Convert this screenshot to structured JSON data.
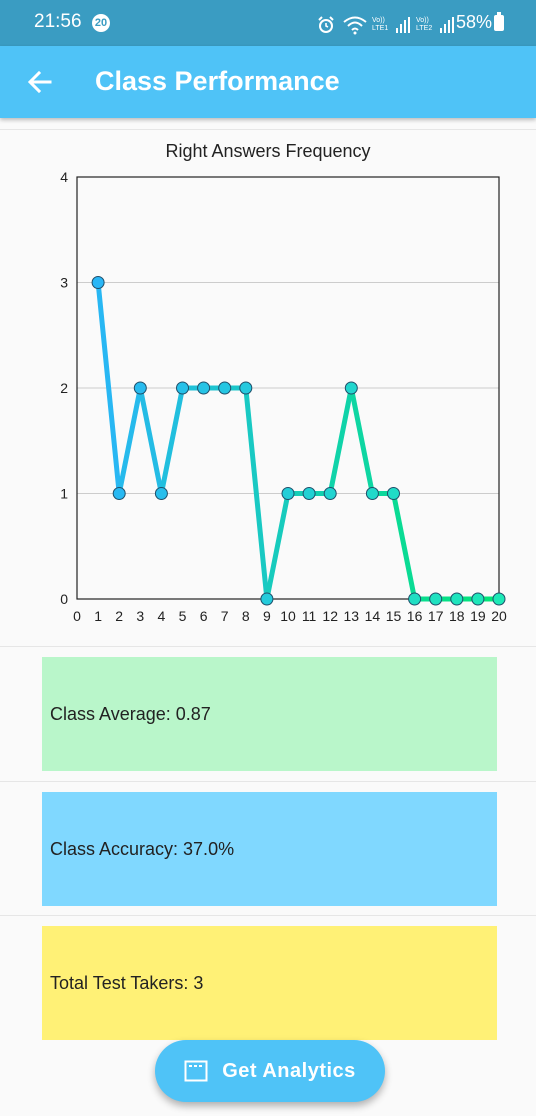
{
  "status_bar": {
    "time": "21:56",
    "notification_count": "20",
    "battery": "58%",
    "sim1": "Vo)) LTE1",
    "sim2": "Vo)) LTE2",
    "icons": [
      "alarm-icon",
      "wifi-icon",
      "signal-icon",
      "signal-icon",
      "battery-icon"
    ]
  },
  "app_bar": {
    "title": "Class Performance",
    "back_icon": "arrow-left-icon"
  },
  "chart_data": {
    "type": "line",
    "title": "Right Answers Frequency",
    "x": [
      1,
      2,
      3,
      4,
      5,
      6,
      7,
      8,
      9,
      10,
      11,
      12,
      13,
      14,
      15,
      16,
      17,
      18,
      19,
      20
    ],
    "y": [
      3,
      1,
      2,
      1,
      2,
      2,
      2,
      2,
      0,
      1,
      1,
      1,
      2,
      1,
      1,
      0,
      0,
      0,
      0,
      0
    ],
    "xlim": [
      0,
      20
    ],
    "ylim": [
      0,
      4
    ],
    "x_ticks": [
      0,
      1,
      2,
      3,
      4,
      5,
      6,
      7,
      8,
      9,
      10,
      11,
      12,
      13,
      14,
      15,
      16,
      17,
      18,
      19,
      20
    ],
    "y_ticks": [
      0,
      1,
      2,
      3,
      4
    ],
    "grid": "horizontal",
    "colors": {
      "line_start": "#29b6f6",
      "line_end": "#00e676",
      "marker_start": "#29b6f6",
      "marker_end": "#1de9b6",
      "grid": "#cccccc"
    }
  },
  "cards": {
    "average": "Class Average: 0.87",
    "accuracy": "Class Accuracy: 37.0%",
    "total": "Total Test Takers: 3"
  },
  "fab": {
    "label": "Get Analytics",
    "icon": "analytics-window-icon"
  },
  "colors": {
    "status_bar": "#3a9cc2",
    "app_bar": "#4fc3f7",
    "card_average": "#b9f6ca",
    "card_accuracy": "#80d8ff",
    "card_total": "#fff176"
  }
}
